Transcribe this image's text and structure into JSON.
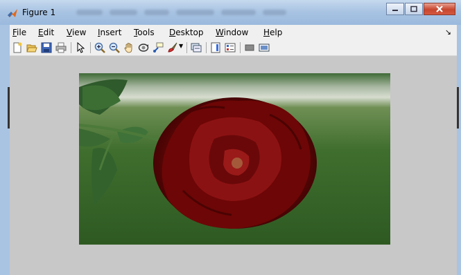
{
  "window": {
    "title": "Figure 1"
  },
  "menubar": {
    "items": [
      {
        "mnemonic": "F",
        "rest": "ile"
      },
      {
        "mnemonic": "E",
        "rest": "dit"
      },
      {
        "mnemonic": "V",
        "rest": "iew"
      },
      {
        "mnemonic": "I",
        "rest": "nsert"
      },
      {
        "mnemonic": "T",
        "rest": "ools"
      },
      {
        "mnemonic": "D",
        "rest": "esktop"
      },
      {
        "mnemonic": "W",
        "rest": "indow"
      },
      {
        "mnemonic": "H",
        "rest": "elp"
      }
    ],
    "overflow_arrow": "↘"
  },
  "toolbar": {
    "icons": [
      "new-figure-icon",
      "open-file-icon",
      "save-icon",
      "print-icon",
      "select-arrow-icon",
      "zoom-in-icon",
      "zoom-out-icon",
      "pan-hand-icon",
      "rotate-3d-icon",
      "data-cursor-icon",
      "brush-icon",
      "link-icon",
      "colorbar-icon",
      "legend-icon",
      "hide-plot-tools-icon",
      "show-plot-tools-icon"
    ]
  },
  "image": {
    "subject": "red-rose-photo"
  },
  "colors": {
    "titlebar": "#a9c4e3",
    "figure_bg": "#c8c8c8",
    "close_button": "#c7462e"
  }
}
